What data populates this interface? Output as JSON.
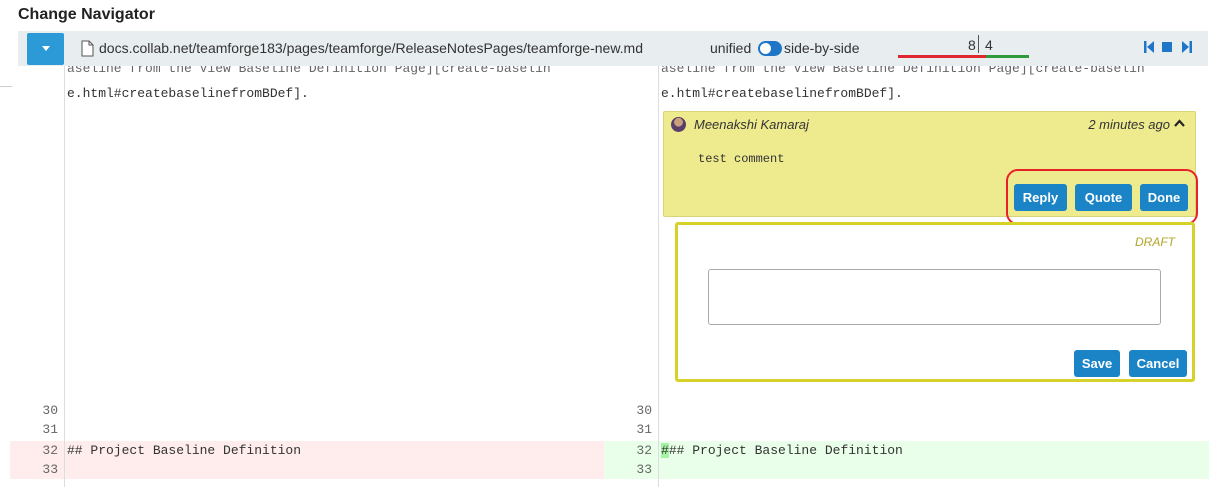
{
  "page": {
    "title": "Change Navigator"
  },
  "navigator": {
    "file_path": "docs.collab.net/teamforge183/pages/teamforge/ReleaseNotesPages/teamforge-new.md",
    "view_unified_label": "unified",
    "view_side_by_side_label": "side-by-side",
    "view_mode": "side-by-side",
    "deleted_count": "8",
    "added_count": "4",
    "icons": [
      "file-icon",
      "chevron-down-icon",
      "first-change-icon",
      "stop-icon",
      "last-change-icon"
    ],
    "colors": {
      "deleted_bar": "#e0262f",
      "added_bar": "#2e9a3a",
      "accent": "#2c9ad6"
    }
  },
  "diff": {
    "left": {
      "top_partial": "aseline from the View Baseline Definition Page][create-baselin",
      "wrap_line": "e.html#createbaselinefromBDef].",
      "lines": [
        {
          "num": "30",
          "text": ""
        },
        {
          "num": "31",
          "text": ""
        },
        {
          "num": "32",
          "text": "## Project Baseline Definition",
          "type": "deleted"
        },
        {
          "num": "33",
          "text": "",
          "type": "deleted"
        }
      ]
    },
    "right": {
      "top_partial": "aseline from the View Baseline Definition Page][create-baselin",
      "wrap_line": "e.html#createbaselinefromBDef].",
      "lines": [
        {
          "num": "30",
          "text": ""
        },
        {
          "num": "31",
          "text": ""
        },
        {
          "num": "32",
          "text_highlight": "#",
          "text": "## Project Baseline Definition",
          "type": "added"
        },
        {
          "num": "33",
          "text": "",
          "type": "added"
        }
      ]
    }
  },
  "comment": {
    "author": "Meenakshi Kamaraj",
    "time": "2 minutes ago",
    "body": "test comment",
    "actions": {
      "reply": "Reply",
      "quote": "Quote",
      "done": "Done"
    }
  },
  "draft": {
    "label": "DRAFT",
    "value": "",
    "actions": {
      "save": "Save",
      "cancel": "Cancel"
    }
  },
  "colors": {
    "deleted_row": "#ffecec",
    "added_row": "#eaffea",
    "comment_bg": "#eeeb8f",
    "button": "#1b84c6",
    "highlight_ring": "#e8202a",
    "draft_border": "#d7d22a"
  }
}
